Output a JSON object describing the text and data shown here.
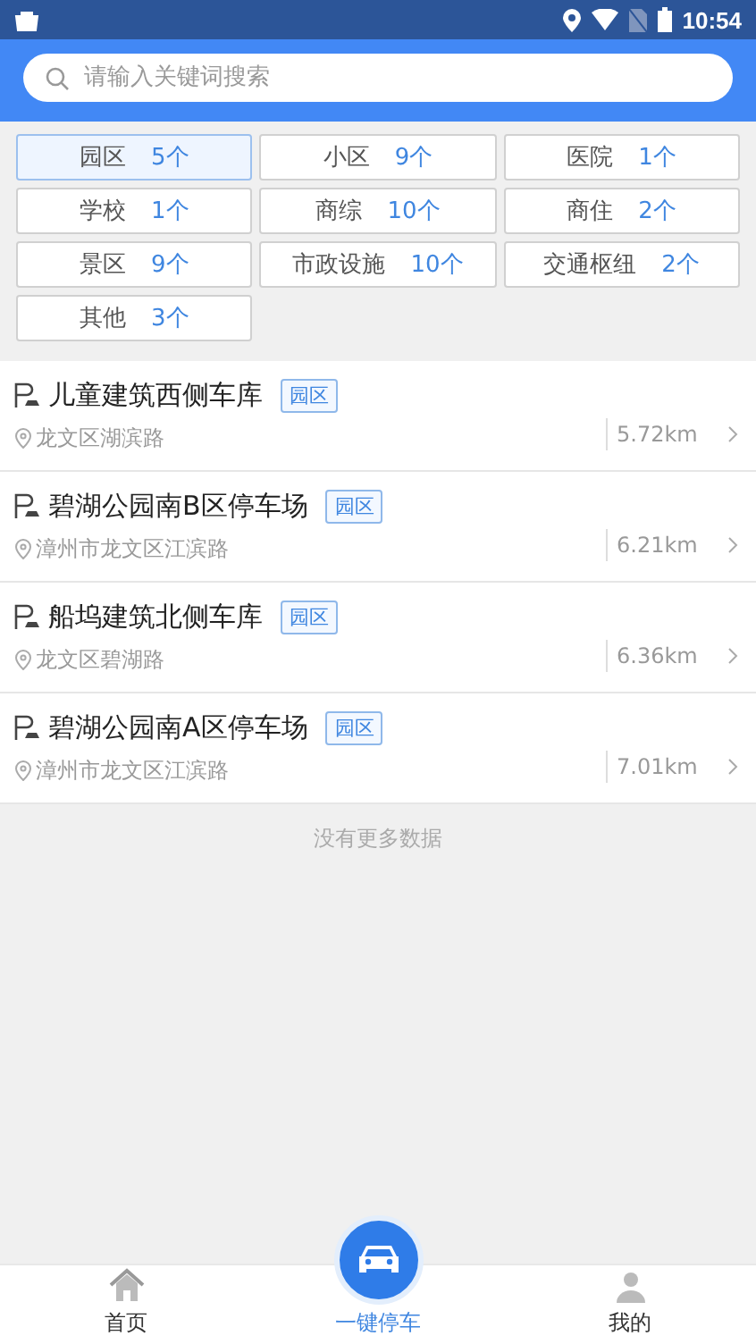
{
  "status_bar": {
    "time": "10:54"
  },
  "search": {
    "placeholder": "请输入关键词搜索"
  },
  "categories": [
    {
      "label": "园区",
      "count": "5个",
      "selected": true
    },
    {
      "label": "小区",
      "count": "9个",
      "selected": false
    },
    {
      "label": "医院",
      "count": "1个",
      "selected": false
    },
    {
      "label": "学校",
      "count": "1个",
      "selected": false
    },
    {
      "label": "商综",
      "count": "10个",
      "selected": false
    },
    {
      "label": "商住",
      "count": "2个",
      "selected": false
    },
    {
      "label": "景区",
      "count": "9个",
      "selected": false
    },
    {
      "label": "市政设施",
      "count": "10个",
      "selected": false
    },
    {
      "label": "交通枢纽",
      "count": "2个",
      "selected": false
    },
    {
      "label": "其他",
      "count": "3个",
      "selected": false
    }
  ],
  "parking_lots": [
    {
      "name": "儿童建筑西侧车库",
      "tag": "园区",
      "address": "龙文区湖滨路",
      "distance": "5.72km"
    },
    {
      "name": "碧湖公园南B区停车场",
      "tag": "园区",
      "address": "漳州市龙文区江滨路",
      "distance": "6.21km"
    },
    {
      "name": "船坞建筑北侧车库",
      "tag": "园区",
      "address": "龙文区碧湖路",
      "distance": "6.36km"
    },
    {
      "name": "碧湖公园南A区停车场",
      "tag": "园区",
      "address": "漳州市龙文区江滨路",
      "distance": "7.01km"
    }
  ],
  "list_footer": "没有更多数据",
  "bottom_nav": [
    {
      "label": "首页",
      "kind": "home",
      "selected": false
    },
    {
      "label": "一键停车",
      "kind": "park",
      "selected": true
    },
    {
      "label": "我的",
      "kind": "profile",
      "selected": false
    }
  ]
}
